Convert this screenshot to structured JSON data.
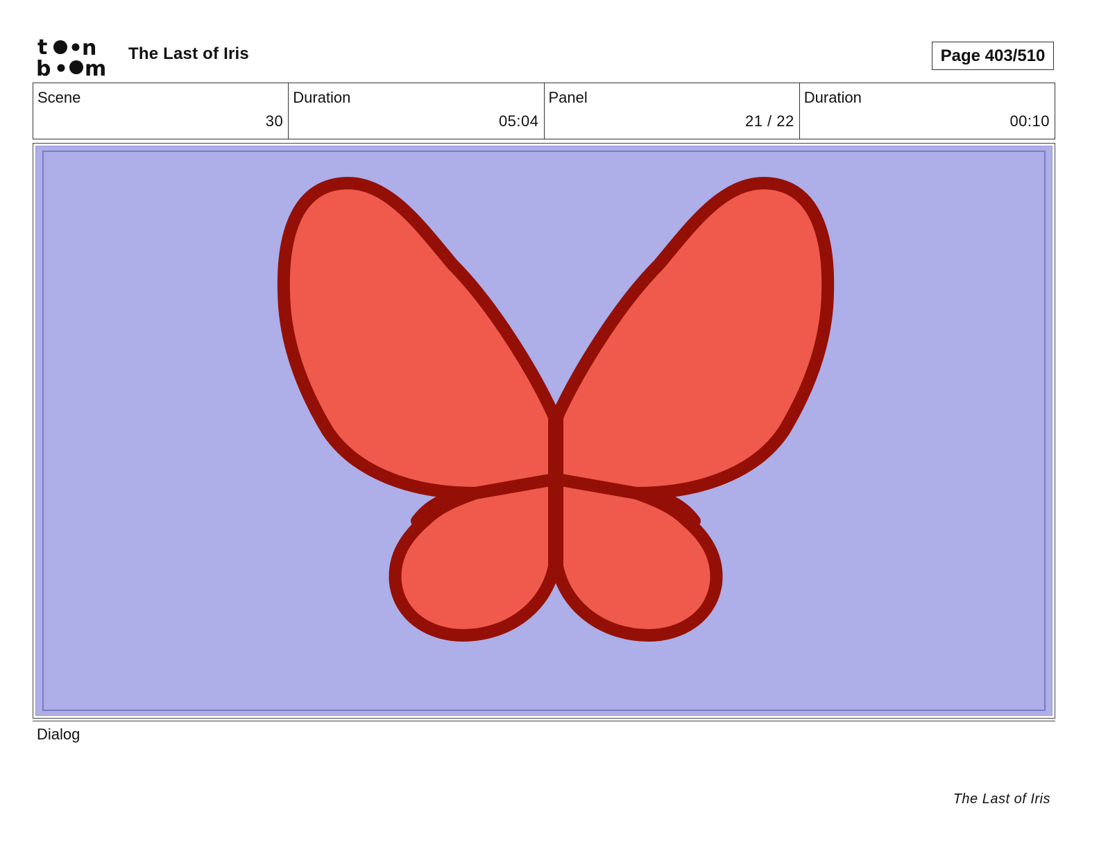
{
  "header": {
    "logo_text": "toon boom",
    "project_title": "The Last of Iris",
    "page_label": "Page 403/510"
  },
  "info": {
    "scene_label": "Scene",
    "scene_value": "30",
    "scene_duration_label": "Duration",
    "scene_duration_value": "05:04",
    "panel_label": "Panel",
    "panel_value": "21 / 22",
    "panel_duration_label": "Duration",
    "panel_duration_value": "00:10"
  },
  "panel": {
    "background_color": "#aeaee8",
    "wing_fill_color": "#ef5a4c",
    "wing_outline_color": "#941006"
  },
  "dialog": {
    "label": "Dialog"
  },
  "footer": {
    "title": "The Last of Iris"
  }
}
